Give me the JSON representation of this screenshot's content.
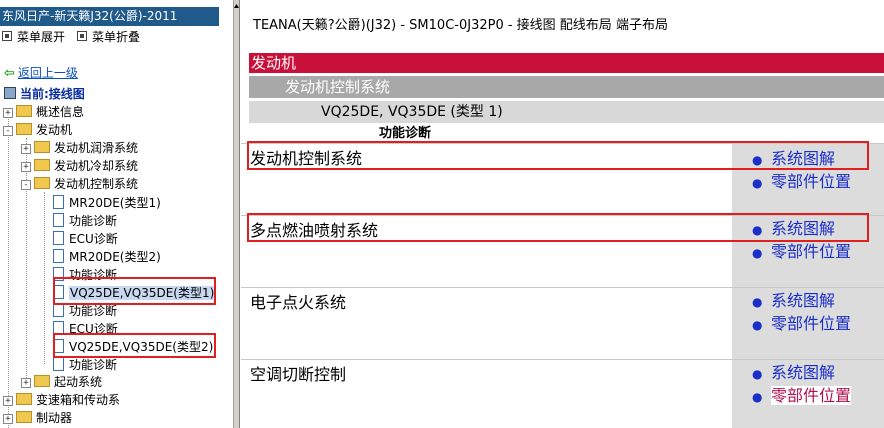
{
  "app_title": "东风日产-新天籁J32(公爵)-2011",
  "menu": {
    "expand": "菜单展开",
    "collapse": "菜单折叠"
  },
  "nav": {
    "back": "返回上一级",
    "current": "当前:接线图"
  },
  "tree": [
    {
      "label": "概述信息",
      "type": "folder",
      "toggle": "+"
    },
    {
      "label": "发动机",
      "type": "folder",
      "toggle": "-"
    },
    {
      "label": "发动机润滑系统",
      "type": "folder",
      "toggle": "+"
    },
    {
      "label": "发动机冷却系统",
      "type": "folder",
      "toggle": "+"
    },
    {
      "label": "发动机控制系统",
      "type": "folder",
      "toggle": "-"
    },
    {
      "label": "MR20DE(类型1)",
      "type": "doc"
    },
    {
      "label": "功能诊断",
      "type": "doc"
    },
    {
      "label": "ECU诊断",
      "type": "doc"
    },
    {
      "label": "MR20DE(类型2)",
      "type": "doc"
    },
    {
      "label": "功能诊断",
      "type": "doc"
    },
    {
      "label": "VQ25DE,VQ35DE(类型1)",
      "type": "doc",
      "selected": true
    },
    {
      "label": "功能诊断",
      "type": "doc"
    },
    {
      "label": "ECU诊断",
      "type": "doc"
    },
    {
      "label": "VQ25DE,VQ35DE(类型2)",
      "type": "doc"
    },
    {
      "label": "功能诊断",
      "type": "doc"
    },
    {
      "label": "起动系统",
      "type": "folder",
      "toggle": "+"
    },
    {
      "label": "变速箱和传动系",
      "type": "folder",
      "toggle": "+"
    },
    {
      "label": "制动器",
      "type": "folder",
      "toggle": "+"
    }
  ],
  "doc": {
    "header": "TEANA(天籁?公爵)(J32) - SM10C-0J32P0 - 接线图 配线布局 端子布局",
    "section": "发动机",
    "subsection": "发动机控制系统",
    "model": "VQ25DE, VQ35DE (类型 1)",
    "subtitle": "功能诊断",
    "systems": [
      {
        "name": "发动机控制系统",
        "links": [
          "系统图解",
          "零部件位置"
        ]
      },
      {
        "name": "多点燃油喷射系统",
        "links": [
          "系统图解",
          "零部件位置"
        ]
      },
      {
        "name": "电子点火系统",
        "links": [
          "系统图解",
          "零部件位置"
        ]
      },
      {
        "name": "空调切断控制",
        "links": [
          "系统图解",
          "零部件位置"
        ]
      }
    ]
  },
  "colors": {
    "title_bar": "#1f5a8a",
    "section_band": "#c8103a",
    "subsection_band": "#a8a8a8",
    "model_band": "#d8d8d8",
    "link": "#1a2ec8",
    "link_hover": "#b01050",
    "highlight_box": "#e02020"
  },
  "icons": {
    "menu_expand": "square-icon",
    "menu_collapse": "square-icon",
    "back": "green-arrow-left-icon",
    "current": "computer-icon",
    "folder": "folder-icon",
    "document": "document-icon"
  }
}
